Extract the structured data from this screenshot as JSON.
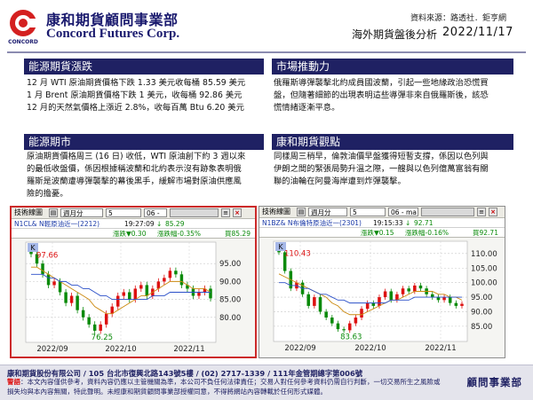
{
  "header": {
    "brand_zh": "康和期貨顧問事業部",
    "brand_en": "Concord Futures Corp.",
    "logo_text": "CONCORD",
    "source": "資料來源：路透社．鉅亨網",
    "report_title": "海外期貨盤後分析",
    "date": "2022/11/17"
  },
  "panels": {
    "energy_futures": {
      "title": "能源期貨漲跌",
      "lines": [
        "12 月 WTI 原油期貨價格下跌 1.33 美元收每桶 85.59 美元",
        "1 月 Brent 原油期貨價格下跌 1 美元，收每桶 92.86 美元",
        "12 月的天然氣價格上漲近 2.8%，收每百萬 Btu 6.20 美元"
      ]
    },
    "market_drivers": {
      "title": "市場推動力",
      "lines": [
        "俄羅斯導彈襲擊北約成員國波蘭，引起一些地緣政治恐慌買",
        "盤，但隨著細節的出現表明這些導彈非來自俄羅斯後，該恐",
        "慌情緒逐漸平息。"
      ]
    },
    "energy_market": {
      "title": "能源期市",
      "lines": [
        "原油期貨價格周三 (16 日) 收低，WTI 原油創下約 3 週以來",
        "的最低收盤價，係因根據稱波蘭和北約表示沒有跡象表明俄",
        "羅斯是波蘭遭導彈襲擊的幕後黑手，緩解市場對原油供應風",
        "險的擔憂。"
      ]
    },
    "outlook": {
      "title": "康和期貨觀點",
      "lines": [
        "同樣周三稍早，倫敦油價早盤獲得短暫支撐，係因以色列與",
        "伊朗之間的緊張局勢升溫之際，一艘與以色列億萬富翁有關",
        "聯的油輪在阿曼海岸遭到炸彈襲擊。"
      ]
    }
  },
  "charts": [
    {
      "widget_title": "技術線圖",
      "period": "週月分",
      "count": "5",
      "contract": "06 -",
      "symbol": "N1CL&  N輕原油近一(2212)",
      "time": "19:27:09",
      "arrow": "↓",
      "price": "85.29",
      "change": "漲跌▼0.30",
      "change_pct": "漲跌幅-0.35%",
      "last": "買85.29",
      "k_label": "K",
      "hi_label": "97.66",
      "lo_label": "76.25",
      "y_ticks": [
        "95.00",
        "90.00",
        "85.00",
        "80.00"
      ],
      "x_labels": [
        "2022/09",
        "2022/10",
        "2022/11"
      ],
      "highlight": "#cc2a2a",
      "chart_data": {
        "type": "line",
        "title": "N1CL&  N輕原油近一(2212)",
        "x": [
          "2022/09",
          "2022/10",
          "2022/11"
        ],
        "y_ticks": [
          80,
          85,
          90,
          95
        ],
        "ylim": [
          74,
          100
        ],
        "high": 97.66,
        "low": 76.25,
        "last": 85.29,
        "series": [
          {
            "values": [
              97.66,
              95,
              92,
              89,
              90,
              87,
              84,
              86,
              82,
              80,
              78,
              76.25,
              78,
              81,
              83,
              86,
              87,
              85,
              88,
              89,
              86,
              88,
              90,
              91,
              93,
              92,
              89,
              88,
              86,
              87,
              88,
              85.29
            ]
          },
          {
            "values": [
              94,
              94,
              93,
              92,
              91,
              90,
              89,
              88,
              87,
              86,
              85,
              83,
              82,
              81,
              81,
              82,
              83,
              84,
              85,
              86,
              86,
              87,
              88,
              89,
              90,
              90,
              90,
              89,
              88,
              88,
              88,
              87
            ]
          },
          {
            "values": [
              92,
              92,
              92,
              91,
              91,
              90,
              90,
              89,
              89,
              88,
              88,
              87,
              86,
              86,
              85,
              85,
              85,
              85,
              85,
              85,
              85,
              86,
              86,
              86,
              87,
              87,
              87,
              87,
              87,
              87,
              87,
              87
            ]
          }
        ]
      }
    },
    {
      "widget_title": "技術線圖",
      "period": "週月分",
      "count": "5",
      "contract": "06 - ma",
      "symbol": "N1BZ&  N布倫特原油近一(2301)",
      "time": "19:15:33",
      "arrow": "↓",
      "price": "92.71",
      "change": "漲跌▼0.15",
      "change_pct": "漲跌幅-0.16%",
      "last": "買92.71",
      "k_label": "K",
      "hi_label": "110.43",
      "lo_label": "83.63",
      "y_ticks": [
        "110.00",
        "105.00",
        "100.00",
        "95.00",
        "90.00",
        "85.00"
      ],
      "x_labels": [
        "2022/09",
        "2022/10",
        "2022/11"
      ],
      "highlight": "#8d8d8d",
      "chart_data": {
        "type": "line",
        "title": "N1BZ&  N布倫特原油近一(2301)",
        "x": [
          "2022/09",
          "2022/10",
          "2022/11"
        ],
        "y_ticks": [
          85,
          90,
          95,
          100,
          105,
          110
        ],
        "ylim": [
          81,
          113
        ],
        "high": 110.43,
        "low": 83.63,
        "last": 92.71,
        "series": [
          {
            "values": [
              110.43,
              104,
              98,
              100,
              96,
              92,
              95,
              90,
              88,
              86,
              84,
              83.63,
              86,
              88,
              91,
              93,
              92,
              95,
              97,
              94,
              96,
              98,
              97,
              99,
              98,
              96,
              95,
              94,
              95,
              93,
              92,
              92.71
            ]
          },
          {
            "values": [
              103,
              102,
              101,
              100,
              99,
              98,
              97,
              96,
              95,
              93,
              92,
              90,
              89,
              89,
              89,
              90,
              91,
              92,
              93,
              94,
              94,
              95,
              96,
              97,
              97,
              97,
              97,
              96,
              96,
              95,
              95,
              94
            ]
          },
          {
            "values": [
              100,
              100,
              99,
              99,
              98,
              98,
              97,
              96,
              96,
              95,
              94,
              94,
              93,
              93,
              93,
              93,
              93,
              93,
              93,
              94,
              94,
              94,
              94,
              95,
              95,
              95,
              95,
              95,
              95,
              95,
              95,
              95
            ]
          }
        ]
      }
    }
  ],
  "footer": {
    "company": "康和期貨股份有限公司 / 105 台北市復興北路143號5樓 / (02) 2717-1339 / 111年金管期總字第006號",
    "warn_label": "警語",
    "disclaimer": "：本文內容僅供參考，資料內容仍應以主管機關為準，本公司不負任何法律責任；交易人對任何參考資料仍需自行判斷，一切交易所生之風險或損失均與本內容無關，特此聲明。未經康和期貨顧問事業部授權同意，不得將網站內容轉載於任何形式媒體。",
    "dept": "顧問事業部"
  },
  "colors": {
    "navy": "#1f2163",
    "candle_up": "#d11",
    "candle_down": "#0a8a0a",
    "ma1": "#cc8a10",
    "ma2": "#2a4fc8",
    "ma3": "#7a7a7a"
  }
}
